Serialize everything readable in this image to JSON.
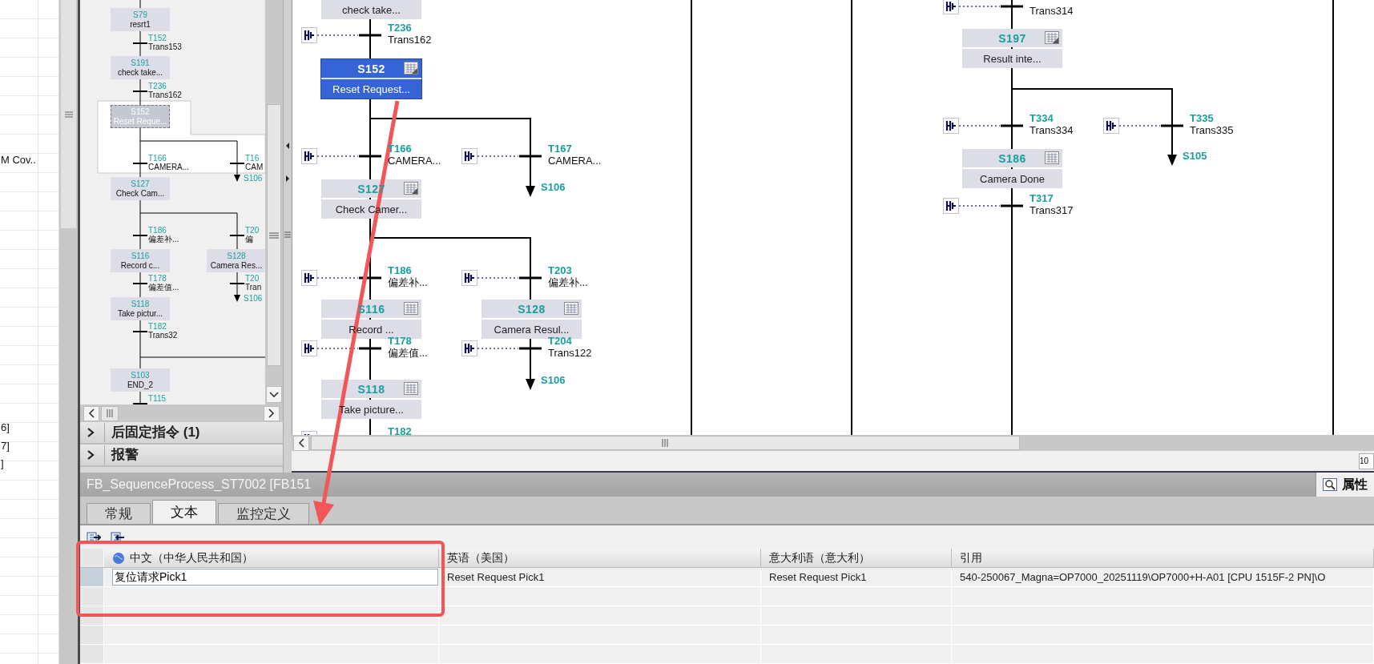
{
  "project_tree": {
    "items": [
      {
        "text": "M Cov.."
      },
      {
        "text": "6]"
      },
      {
        "text": "7]"
      },
      {
        "text": "]"
      }
    ]
  },
  "overview": {
    "steps": [
      {
        "number": "S79",
        "name": "resrt1",
        "selected": false
      },
      {
        "number": "S191",
        "name": "check take...",
        "selected": false
      },
      {
        "number": "S152",
        "name": "Reset Reque...",
        "selected": true
      },
      {
        "number": "S127",
        "name": "Check Cam...",
        "selected": false
      },
      {
        "number": "S116",
        "name": "Record c...",
        "selected": false
      },
      {
        "number": "S128",
        "name": "Camera Res...",
        "selected": false
      },
      {
        "number": "S118",
        "name": "Take pictur...",
        "selected": false
      },
      {
        "number": "S103",
        "name": "END_2",
        "selected": false
      }
    ],
    "transitions": [
      {
        "number": "T152",
        "name": "Trans153"
      },
      {
        "number": "T236",
        "name": "Trans162"
      },
      {
        "number": "T166",
        "name": "CAMERA..."
      },
      {
        "number": "T16",
        "name": "CAM"
      },
      {
        "number": "T186",
        "name": "偏差补..."
      },
      {
        "number": "T20",
        "name": "偏"
      },
      {
        "number": "T178",
        "name": "偏差值..."
      },
      {
        "number": "T20",
        "name": "Tran"
      },
      {
        "number": "T182",
        "name": "Trans32"
      },
      {
        "number": "T115"
      }
    ],
    "jumps": [
      "S106",
      "S106"
    ]
  },
  "sections": [
    {
      "label": "后固定指令 (1)",
      "expanded": false
    },
    {
      "label": "报警",
      "expanded": false
    }
  ],
  "sfc": {
    "steps": [
      {
        "name": "check take...",
        "selected": false
      },
      {
        "number": "S152",
        "name": "Reset Request...",
        "selected": true,
        "kind": "edited"
      },
      {
        "number": "S127",
        "name": "Check Camer...",
        "selected": false,
        "kind": "edited"
      },
      {
        "number": "S116",
        "name": "Record ...",
        "selected": false,
        "kind": "plain"
      },
      {
        "number": "S128",
        "name": "Camera Resul...",
        "selected": false,
        "kind": "plain"
      },
      {
        "number": "S118",
        "name": "Take picture...",
        "selected": false,
        "kind": "plain"
      },
      {
        "number": "S197",
        "name": "Result inte...",
        "selected": false,
        "kind": "edited"
      },
      {
        "number": "S186",
        "name": "Camera Done",
        "selected": false,
        "kind": "plain"
      }
    ],
    "transitions": [
      {
        "number": "T236",
        "name": "Trans162"
      },
      {
        "number": "T166",
        "name": "CAMERA..."
      },
      {
        "number": "T167",
        "name": "CAMERA..."
      },
      {
        "number": "T186",
        "name": "偏差补..."
      },
      {
        "number": "T203",
        "name": "偏差补..."
      },
      {
        "number": "T178",
        "name": "偏差值..."
      },
      {
        "number": "T204",
        "name": "Trans122"
      },
      {
        "number": "T182"
      },
      {
        "name": "Trans314"
      },
      {
        "number": "T334",
        "name": "Trans334"
      },
      {
        "number": "T335",
        "name": "Trans335"
      },
      {
        "number": "T317",
        "name": "Trans317"
      }
    ],
    "jumps": [
      "S106",
      "S106",
      "S105"
    ]
  },
  "zoom_field": {
    "value": "10"
  },
  "properties_panel": {
    "title": "FB_SequenceProcess_ST7002 [FB151",
    "properties_tab": "属性",
    "tabs": [
      {
        "label": "常规",
        "selected": false
      },
      {
        "label": "文本",
        "selected": true
      },
      {
        "label": "监控定义",
        "selected": false
      }
    ],
    "table": {
      "columns": [
        "中文（中华人民共和国）",
        "英语（美国）",
        "意大利语（意大利）",
        "引用"
      ],
      "rows": [
        {
          "selected": true,
          "cells": [
            "复位请求Pick1",
            "Reset Request Pick1",
            "Reset Request Pick1",
            "540-250067_Magna=OP7000_20251119\\OP7000+H-A01 [CPU 1515F-2 PN]\\O"
          ]
        }
      ]
    }
  }
}
